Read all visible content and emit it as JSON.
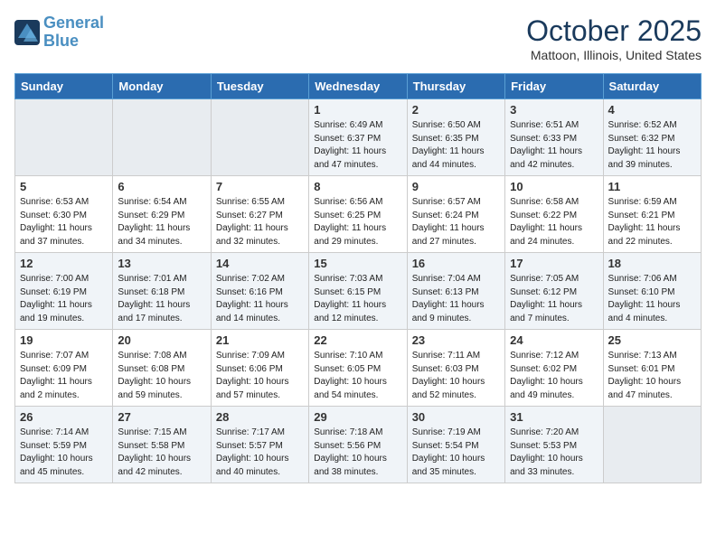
{
  "header": {
    "logo_line1": "General",
    "logo_line2": "Blue",
    "month_title": "October 2025",
    "location": "Mattoon, Illinois, United States"
  },
  "weekdays": [
    "Sunday",
    "Monday",
    "Tuesday",
    "Wednesday",
    "Thursday",
    "Friday",
    "Saturday"
  ],
  "weeks": [
    [
      {
        "num": "",
        "info": ""
      },
      {
        "num": "",
        "info": ""
      },
      {
        "num": "",
        "info": ""
      },
      {
        "num": "1",
        "info": "Sunrise: 6:49 AM\nSunset: 6:37 PM\nDaylight: 11 hours\nand 47 minutes."
      },
      {
        "num": "2",
        "info": "Sunrise: 6:50 AM\nSunset: 6:35 PM\nDaylight: 11 hours\nand 44 minutes."
      },
      {
        "num": "3",
        "info": "Sunrise: 6:51 AM\nSunset: 6:33 PM\nDaylight: 11 hours\nand 42 minutes."
      },
      {
        "num": "4",
        "info": "Sunrise: 6:52 AM\nSunset: 6:32 PM\nDaylight: 11 hours\nand 39 minutes."
      }
    ],
    [
      {
        "num": "5",
        "info": "Sunrise: 6:53 AM\nSunset: 6:30 PM\nDaylight: 11 hours\nand 37 minutes."
      },
      {
        "num": "6",
        "info": "Sunrise: 6:54 AM\nSunset: 6:29 PM\nDaylight: 11 hours\nand 34 minutes."
      },
      {
        "num": "7",
        "info": "Sunrise: 6:55 AM\nSunset: 6:27 PM\nDaylight: 11 hours\nand 32 minutes."
      },
      {
        "num": "8",
        "info": "Sunrise: 6:56 AM\nSunset: 6:25 PM\nDaylight: 11 hours\nand 29 minutes."
      },
      {
        "num": "9",
        "info": "Sunrise: 6:57 AM\nSunset: 6:24 PM\nDaylight: 11 hours\nand 27 minutes."
      },
      {
        "num": "10",
        "info": "Sunrise: 6:58 AM\nSunset: 6:22 PM\nDaylight: 11 hours\nand 24 minutes."
      },
      {
        "num": "11",
        "info": "Sunrise: 6:59 AM\nSunset: 6:21 PM\nDaylight: 11 hours\nand 22 minutes."
      }
    ],
    [
      {
        "num": "12",
        "info": "Sunrise: 7:00 AM\nSunset: 6:19 PM\nDaylight: 11 hours\nand 19 minutes."
      },
      {
        "num": "13",
        "info": "Sunrise: 7:01 AM\nSunset: 6:18 PM\nDaylight: 11 hours\nand 17 minutes."
      },
      {
        "num": "14",
        "info": "Sunrise: 7:02 AM\nSunset: 6:16 PM\nDaylight: 11 hours\nand 14 minutes."
      },
      {
        "num": "15",
        "info": "Sunrise: 7:03 AM\nSunset: 6:15 PM\nDaylight: 11 hours\nand 12 minutes."
      },
      {
        "num": "16",
        "info": "Sunrise: 7:04 AM\nSunset: 6:13 PM\nDaylight: 11 hours\nand 9 minutes."
      },
      {
        "num": "17",
        "info": "Sunrise: 7:05 AM\nSunset: 6:12 PM\nDaylight: 11 hours\nand 7 minutes."
      },
      {
        "num": "18",
        "info": "Sunrise: 7:06 AM\nSunset: 6:10 PM\nDaylight: 11 hours\nand 4 minutes."
      }
    ],
    [
      {
        "num": "19",
        "info": "Sunrise: 7:07 AM\nSunset: 6:09 PM\nDaylight: 11 hours\nand 2 minutes."
      },
      {
        "num": "20",
        "info": "Sunrise: 7:08 AM\nSunset: 6:08 PM\nDaylight: 10 hours\nand 59 minutes."
      },
      {
        "num": "21",
        "info": "Sunrise: 7:09 AM\nSunset: 6:06 PM\nDaylight: 10 hours\nand 57 minutes."
      },
      {
        "num": "22",
        "info": "Sunrise: 7:10 AM\nSunset: 6:05 PM\nDaylight: 10 hours\nand 54 minutes."
      },
      {
        "num": "23",
        "info": "Sunrise: 7:11 AM\nSunset: 6:03 PM\nDaylight: 10 hours\nand 52 minutes."
      },
      {
        "num": "24",
        "info": "Sunrise: 7:12 AM\nSunset: 6:02 PM\nDaylight: 10 hours\nand 49 minutes."
      },
      {
        "num": "25",
        "info": "Sunrise: 7:13 AM\nSunset: 6:01 PM\nDaylight: 10 hours\nand 47 minutes."
      }
    ],
    [
      {
        "num": "26",
        "info": "Sunrise: 7:14 AM\nSunset: 5:59 PM\nDaylight: 10 hours\nand 45 minutes."
      },
      {
        "num": "27",
        "info": "Sunrise: 7:15 AM\nSunset: 5:58 PM\nDaylight: 10 hours\nand 42 minutes."
      },
      {
        "num": "28",
        "info": "Sunrise: 7:17 AM\nSunset: 5:57 PM\nDaylight: 10 hours\nand 40 minutes."
      },
      {
        "num": "29",
        "info": "Sunrise: 7:18 AM\nSunset: 5:56 PM\nDaylight: 10 hours\nand 38 minutes."
      },
      {
        "num": "30",
        "info": "Sunrise: 7:19 AM\nSunset: 5:54 PM\nDaylight: 10 hours\nand 35 minutes."
      },
      {
        "num": "31",
        "info": "Sunrise: 7:20 AM\nSunset: 5:53 PM\nDaylight: 10 hours\nand 33 minutes."
      },
      {
        "num": "",
        "info": ""
      }
    ]
  ]
}
